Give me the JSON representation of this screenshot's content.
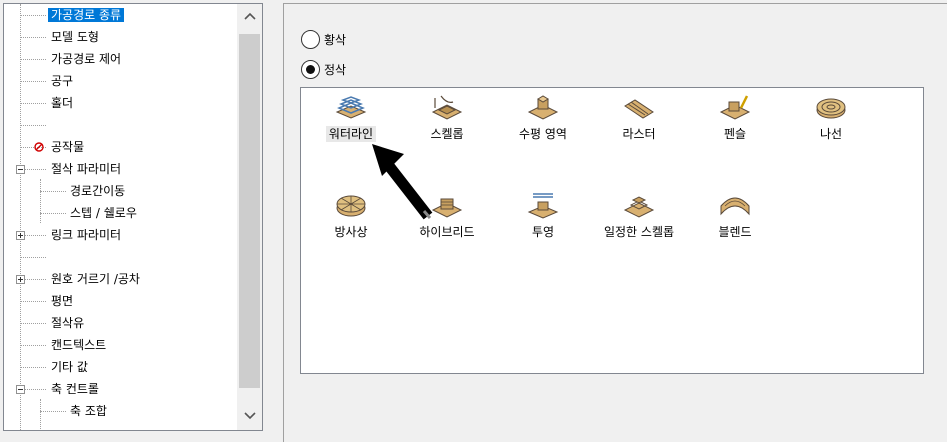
{
  "tree": {
    "items": [
      {
        "label": "가공경로 종류",
        "selected": true
      },
      {
        "label": "모델 도형"
      },
      {
        "label": "가공경로 제어"
      },
      {
        "label": "공구"
      },
      {
        "label": "홀더"
      },
      {
        "label": ""
      },
      {
        "label": "공작물",
        "icon": "no-entry-icon"
      },
      {
        "label": "절삭 파라미터",
        "expander": "minus"
      },
      {
        "label": "경로간이동"
      },
      {
        "label": "스텝 / 쉘로우"
      },
      {
        "label": "링크 파라미터",
        "expander": "plus"
      },
      {
        "label": ""
      },
      {
        "label": "원호 거르기 /공차",
        "expander": "plus"
      },
      {
        "label": "평면"
      },
      {
        "label": "절삭유"
      },
      {
        "label": "캔드텍스트"
      },
      {
        "label": "기타 값"
      },
      {
        "label": "축 컨트롤",
        "expander": "minus"
      },
      {
        "label": "축 조합"
      }
    ],
    "scroll_up_icon": "chevron-up-icon",
    "scroll_down_icon": "chevron-down-icon"
  },
  "mode": {
    "options": [
      {
        "label": "황삭",
        "checked": false
      },
      {
        "label": "정삭",
        "checked": true
      }
    ]
  },
  "strategies": {
    "row1": [
      "워터라인",
      "스켈롭",
      "수평 영역",
      "라스터",
      "펜슬",
      "나선"
    ],
    "row2": [
      "방사상",
      "하이브리드",
      "투영",
      "일정한 스켈롭",
      "블렌드"
    ]
  },
  "colors": {
    "selection": "#0078d7",
    "icon_tan": "#d8b070",
    "icon_dark": "#5a4a3a"
  }
}
